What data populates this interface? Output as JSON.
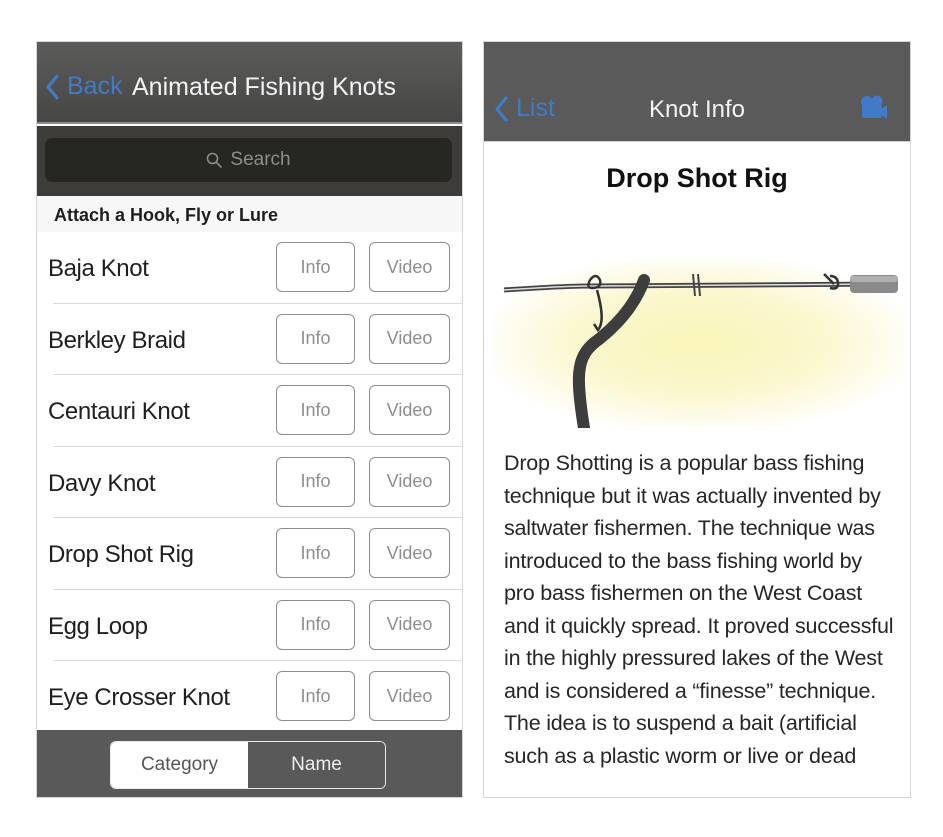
{
  "left_screen": {
    "navbar": {
      "back_label": "Back",
      "title": "Animated Fishing Knots",
      "accent_color": "#3f7bc9"
    },
    "search": {
      "placeholder": "Search",
      "icon": "search-icon"
    },
    "section_header": "Attach a Hook, Fly or Lure",
    "knots": [
      {
        "name": "Baja Knot",
        "info_label": "Info",
        "video_label": "Video"
      },
      {
        "name": "Berkley Braid",
        "info_label": "Info",
        "video_label": "Video"
      },
      {
        "name": "Centauri Knot",
        "info_label": "Info",
        "video_label": "Video"
      },
      {
        "name": "Davy Knot",
        "info_label": "Info",
        "video_label": "Video"
      },
      {
        "name": "Drop Shot Rig",
        "info_label": "Info",
        "video_label": "Video"
      },
      {
        "name": "Egg Loop",
        "info_label": "Info",
        "video_label": "Video"
      },
      {
        "name": "Eye Crosser Knot",
        "info_label": "Info",
        "video_label": "Video"
      }
    ],
    "segmented_control": {
      "options": [
        "Category",
        "Name"
      ],
      "selected": "Name"
    }
  },
  "right_screen": {
    "navbar": {
      "back_label": "List",
      "title": "Knot Info",
      "right_icon": "video-camera-icon"
    },
    "knot_title": "Drop Shot Rig",
    "illustration": "drop-shot-rig-diagram",
    "description": "Drop Shotting is a popular bass fishing technique but it was actually invented by saltwater fishermen. The technique was introduced to the bass fishing world by pro bass fishermen on the West Coast and it quickly spread. It proved successful in the highly pressured lakes of the West and is considered a “finesse” technique. The idea is to suspend a bait (artificial such as a plastic worm or live or dead"
  }
}
